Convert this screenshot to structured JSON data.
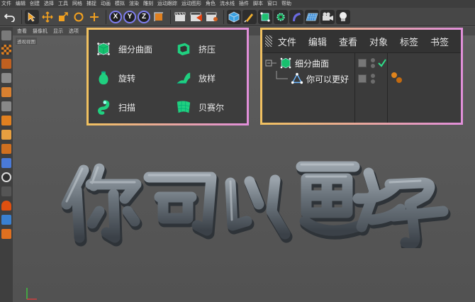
{
  "menubar": [
    "文件",
    "编辑",
    "创建",
    "选择",
    "工具",
    "网格",
    "捕捉",
    "动画",
    "模拟",
    "渲染",
    "雕刻",
    "运动跟踪",
    "运动图形",
    "角色",
    "流水线",
    "插件",
    "脚本",
    "窗口",
    "帮助"
  ],
  "toolbar": {
    "axis_x": "X",
    "axis_y": "Y",
    "axis_z": "Z"
  },
  "viewport": {
    "menu": [
      "查看",
      "摄像机",
      "显示",
      "选项"
    ],
    "label": "透视视图"
  },
  "popup": {
    "items": [
      {
        "label": "细分曲面",
        "icon": "subdivision-surface-icon"
      },
      {
        "label": "挤压",
        "icon": "extrude-icon"
      },
      {
        "label": "旋转",
        "icon": "lathe-icon"
      },
      {
        "label": "放样",
        "icon": "loft-icon"
      },
      {
        "label": "扫描",
        "icon": "sweep-icon"
      },
      {
        "label": "贝赛尔",
        "icon": "bezier-icon"
      }
    ]
  },
  "object_manager": {
    "menu": [
      "文件",
      "编辑",
      "查看",
      "对象",
      "标签",
      "书签"
    ],
    "objects": [
      {
        "name": "细分曲面",
        "icon": "subdivision-surface-icon"
      },
      {
        "name": "你可以更好",
        "icon": "text-spline-icon"
      }
    ]
  },
  "scene_text": "你可以更好",
  "colors": {
    "accent_green": "#1fd07a",
    "popup_border_start": "#f0c060",
    "popup_border_end": "#e18fd9",
    "tag_orange": "#e0841c"
  }
}
